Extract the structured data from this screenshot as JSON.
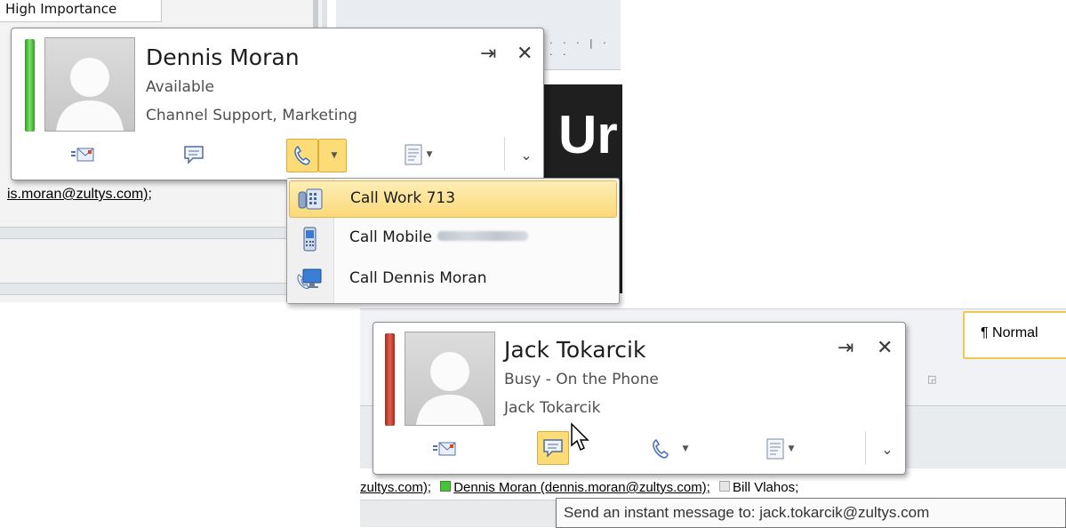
{
  "background": {
    "high_importance": "High Importance",
    "doc_letters": "Ur",
    "email_line": "is.moran@zultys.com);",
    "style_normal": "¶ Normal",
    "recipients": {
      "left": "zultys.com);",
      "middle": "Dennis Moran (dennis.moran@zultys.com);",
      "right": "Bill Vlahos;"
    }
  },
  "card_dennis": {
    "name": "Dennis Moran",
    "status": "Available",
    "detail": "Channel Support, Marketing",
    "status_color": "#3bb22b",
    "actions": [
      "email-icon",
      "im-icon",
      "phone-icon",
      "contact-card-icon",
      "expand-chevron-icon"
    ]
  },
  "call_menu": {
    "items": [
      {
        "label": "Call Work 713",
        "icon": "desk-phone-icon",
        "highlighted": true
      },
      {
        "label": "Call Mobile",
        "icon": "mobile-phone-icon",
        "highlighted": false
      },
      {
        "label": "Call Dennis Moran",
        "icon": "pc-phone-icon",
        "highlighted": false
      }
    ]
  },
  "card_jack": {
    "name": "Jack Tokarcik",
    "status": "Busy - On the Phone",
    "detail": "Jack Tokarcik",
    "status_color": "#c83a2a",
    "actions": [
      "email-icon",
      "im-icon",
      "phone-icon",
      "contact-card-icon",
      "expand-chevron-icon"
    ]
  },
  "tooltip": {
    "text": "Send an instant message to: jack.tokarcik@zultys.com"
  }
}
